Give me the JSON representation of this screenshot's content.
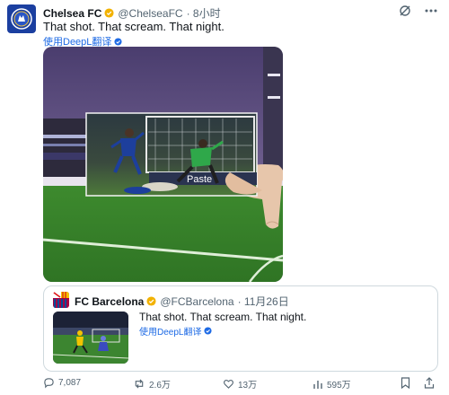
{
  "tweet": {
    "author_name": "Chelsea FC",
    "author_handle": "@ChelseaFC",
    "time": "· 8小时",
    "text": "That shot. That scream. That night.",
    "translate_label": "使用DeepL翻译"
  },
  "quote": {
    "author_name": "FC Barcelona",
    "author_handle": "@FCBarcelona",
    "time": "· 11月26日",
    "text": "That shot. That scream. That night.",
    "translate_label": "使用DeepL翻译"
  },
  "media": {
    "board_text": "Paste"
  },
  "actions": {
    "replies": "7,087",
    "reposts": "2.6万",
    "likes": "13万",
    "views": "595万"
  },
  "colors": {
    "verified": "#f2b200",
    "link": "#1d6ae5",
    "chelsea_blue": "#1b3fa0"
  }
}
